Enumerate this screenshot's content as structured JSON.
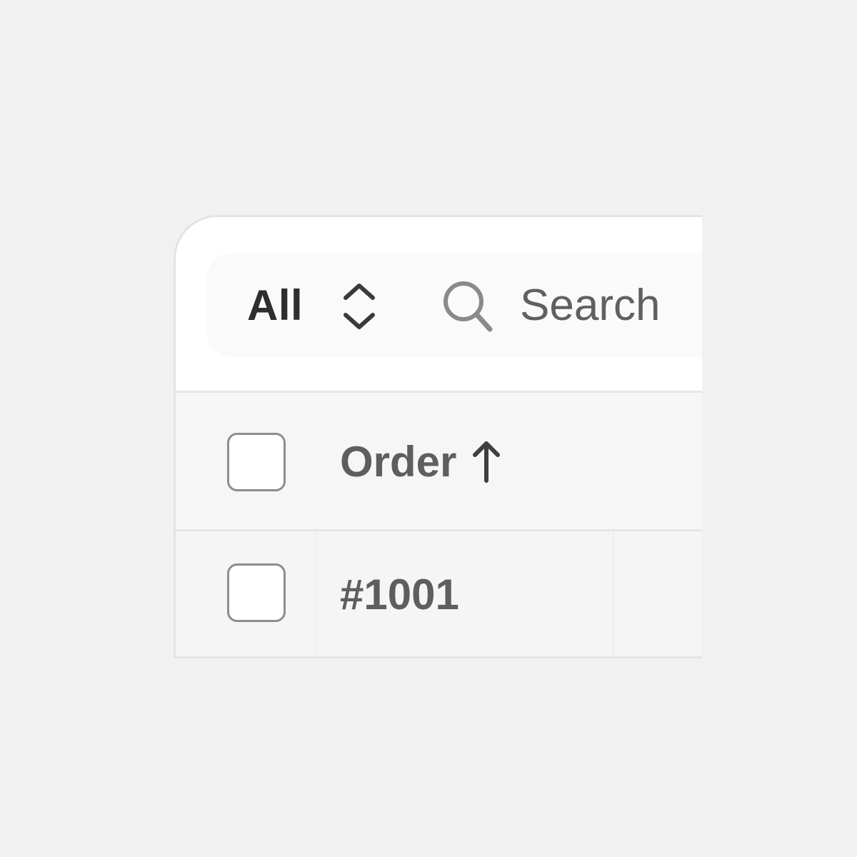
{
  "toolbar": {
    "filter_value": "All",
    "filter_icon": "chevron-up-down-icon",
    "search_icon": "search-icon",
    "search_placeholder": "Search"
  },
  "table": {
    "header": {
      "order_label": "Order",
      "sort_icon": "arrow-up-icon"
    },
    "rows": [
      {
        "order": "#1001"
      }
    ]
  },
  "colors": {
    "background": "#f1f1f1",
    "card": "#ffffff",
    "row": "#f6f6f6",
    "text_primary": "#2e2e2e",
    "text_secondary": "#5e5e5e",
    "border": "#e3e3e3"
  }
}
